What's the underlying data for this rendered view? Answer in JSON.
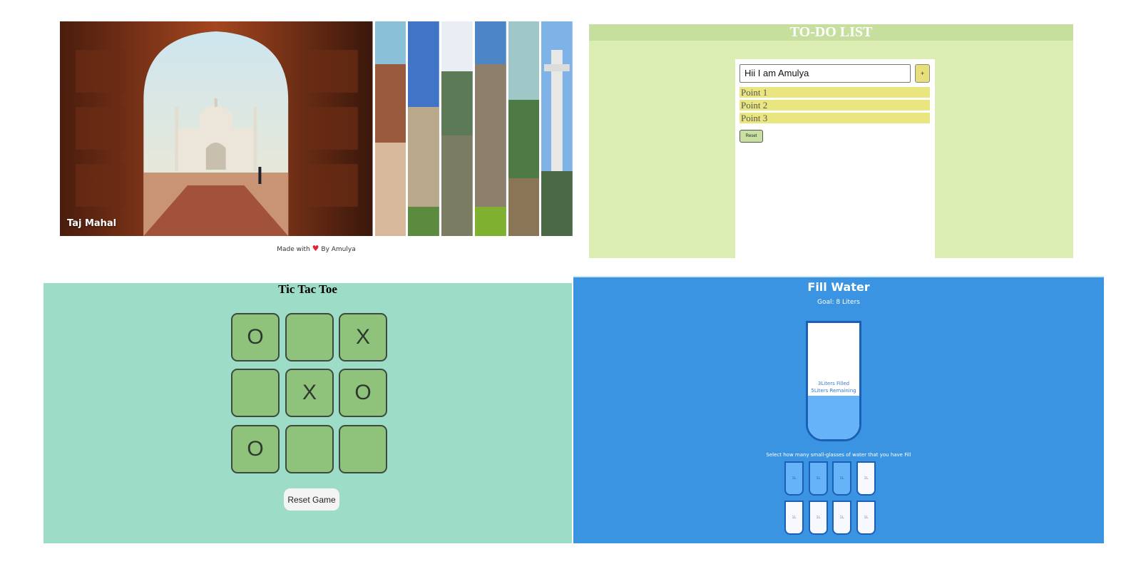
{
  "gallery": {
    "caption": "Taj Mahal",
    "footer_text_before": "Made with",
    "footer_icon": "heart-icon",
    "footer_text_after": "By Amulya",
    "thin_panel_count": 6
  },
  "todo": {
    "title": "TO-DO LIST",
    "input_value": "Hii I am Amulya",
    "add_label": "+",
    "items": [
      "Point 1",
      "Point 2",
      "Point 3"
    ],
    "reset_label": "Reset",
    "colors": {
      "background": "#dcedb3",
      "header": "#c6df9e",
      "item": "#e9e67f"
    }
  },
  "tictactoe": {
    "title": "Tic Tac Toe",
    "cells": [
      "O",
      "",
      "X",
      "",
      "X",
      "O",
      "O",
      "",
      ""
    ],
    "reset_label": "Reset Game",
    "colors": {
      "background": "#9ddcc6",
      "cell": "#8fc27a"
    }
  },
  "water": {
    "title": "Fill Water",
    "goal": "Goal: 8 Liters",
    "filled_text": "3Liters Filled",
    "remaining_text": "5Liters Remaining",
    "filled_fraction": 0.375,
    "select_text": "Select how many small-glasses of water that you have Fill",
    "cup_label": "1L",
    "cups_full": [
      true,
      true,
      true,
      false,
      false,
      false,
      false,
      false
    ],
    "colors": {
      "background": "#3a94e2",
      "water": "#66b3f7",
      "border": "#1a5fb8"
    }
  }
}
